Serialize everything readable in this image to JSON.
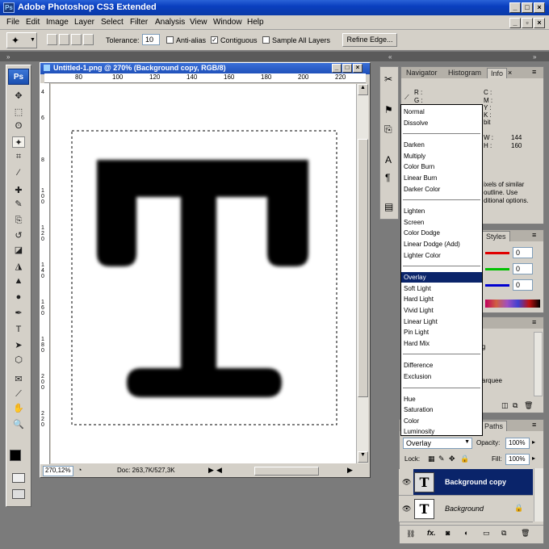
{
  "app": {
    "title": "Adobe Photoshop CS3 Extended",
    "logo": "Ps",
    "window_buttons": [
      "_",
      "□",
      "×"
    ]
  },
  "menu": [
    "File",
    "Edit",
    "Image",
    "Layer",
    "Select",
    "Filter",
    "Analysis",
    "View",
    "Window",
    "Help"
  ],
  "options_bar": {
    "tolerance_label": "Tolerance:",
    "tolerance_value": "10",
    "anti_alias_label": "Anti-alias",
    "anti_alias_checked": false,
    "contiguous_label": "Contiguous",
    "contiguous_checked": true,
    "sample_all_label": "Sample All Layers",
    "sample_all_checked": false,
    "refine_edge_label": "Refine Edge..."
  },
  "toolbox": {
    "badge": "Ps",
    "tools": [
      "move-tool-icon",
      "marquee-tool-icon",
      "lasso-tool-icon",
      "magic-wand-tool-icon",
      "crop-tool-icon",
      "slice-tool-icon",
      "healing-brush-icon",
      "brush-tool-icon",
      "clone-stamp-icon",
      "history-brush-icon",
      "eraser-tool-icon",
      "paint-bucket-icon",
      "blur-tool-icon",
      "dodge-tool-icon",
      "pen-tool-icon",
      "type-tool-icon",
      "path-selection-icon",
      "shape-tool-icon",
      "notes-tool-icon",
      "eyedropper-icon",
      "hand-tool-icon",
      "zoom-tool-icon"
    ],
    "glyphs": [
      "✥",
      "⬚",
      "ʘ",
      "✦",
      "⌗",
      "⁄",
      "✚",
      "✎",
      "⎘",
      "↺",
      "◪",
      "◮",
      "▲",
      "●",
      "✒",
      "T",
      "➤",
      "⬡",
      "✉",
      "⟋",
      "✋",
      "🔍"
    ]
  },
  "document": {
    "title": "Untitled-1.png @ 270% (Background copy, RGB/8)",
    "zoom": "270,12%",
    "doc_info": "Doc: 263,7K/527,3K",
    "ruler_ticks": [
      "80",
      "100",
      "120",
      "140",
      "160",
      "180",
      "200",
      "220"
    ],
    "ruler_left_ticks": [
      "4",
      "6",
      "8",
      "1\n0\n0",
      "1\n2\n0",
      "1\n4\n0",
      "1\n6\n0",
      "1\n8\n0",
      "2\n0\n0",
      "2\n2\n0"
    ],
    "letter": "T"
  },
  "navigator_panel": {
    "tabs": [
      "Navigator",
      "Histogram",
      "Info"
    ],
    "active_tab": "Info",
    "info_left": [
      "R :",
      "G :"
    ],
    "info_right": [
      "C :",
      "M :",
      "Y :",
      "K :",
      "bit"
    ],
    "w_label": "W :",
    "w_value": "144",
    "h_label": "H :",
    "h_value": "160",
    "help_text": [
      "ixels of similar",
      "outline.  Use",
      "ditional options."
    ]
  },
  "color_panel": {
    "tab": "Styles",
    "values": [
      "0",
      "0",
      "0"
    ]
  },
  "history_panel": {
    "partial_text": [
      "g",
      "arquee"
    ]
  },
  "layers_panel": {
    "tab": "Paths",
    "blend_mode": "Overlay",
    "opacity_label": "Opacity:",
    "opacity_value": "100%",
    "lock_label": "Lock:",
    "fill_label": "Fill:",
    "fill_value": "100%",
    "layers": [
      {
        "name": "Background copy",
        "selected": true,
        "thumb": "T"
      },
      {
        "name": "Background",
        "selected": false,
        "thumb": "T"
      }
    ],
    "footer_icons": [
      "link-icon",
      "fx-icon",
      "mask-icon",
      "adjustment-icon",
      "group-icon",
      "new-layer-icon",
      "trash-icon"
    ]
  },
  "blend_modes": {
    "groups": [
      [
        "Normal",
        "Dissolve"
      ],
      [
        "Darken",
        "Multiply",
        "Color Burn",
        "Linear Burn",
        "Darker Color"
      ],
      [
        "Lighten",
        "Screen",
        "Color Dodge",
        "Linear Dodge (Add)",
        "Lighter Color"
      ],
      [
        "Overlay",
        "Soft Light",
        "Hard Light",
        "Vivid Light",
        "Linear Light",
        "Pin Light",
        "Hard Mix"
      ],
      [
        "Difference",
        "Exclusion"
      ],
      [
        "Hue",
        "Saturation",
        "Color",
        "Luminosity"
      ]
    ],
    "selected": "Overlay"
  },
  "colors": {
    "selection_blue": "#0a246a",
    "layer_selected": "#0a246a"
  }
}
